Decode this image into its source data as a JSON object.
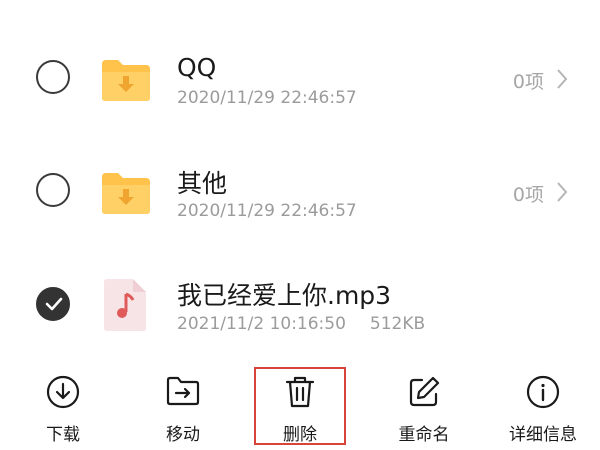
{
  "files": [
    {
      "name": "QQ",
      "date": "2020/11/29 22:46:57",
      "size": "",
      "count": "0项",
      "type": "folder",
      "selected": false
    },
    {
      "name": "其他",
      "date": "2020/11/29 22:46:57",
      "size": "",
      "count": "0项",
      "type": "folder",
      "selected": false
    },
    {
      "name": "我已经爱上你.mp3",
      "date": "2021/11/2 10:16:50",
      "size": "512KB",
      "count": "",
      "type": "audio",
      "selected": true
    }
  ],
  "toolbar": {
    "download": "下载",
    "move": "移动",
    "delete": "删除",
    "rename": "重命名",
    "details": "详细信息"
  },
  "colors": {
    "folder": "#ffc34c",
    "audio_note": "#e05a5a",
    "highlight": "#d9443a",
    "checked": "#333333"
  },
  "icons": {
    "download": "download-icon",
    "move": "move-icon",
    "delete": "trash-icon",
    "rename": "edit-icon",
    "details": "info-icon"
  }
}
